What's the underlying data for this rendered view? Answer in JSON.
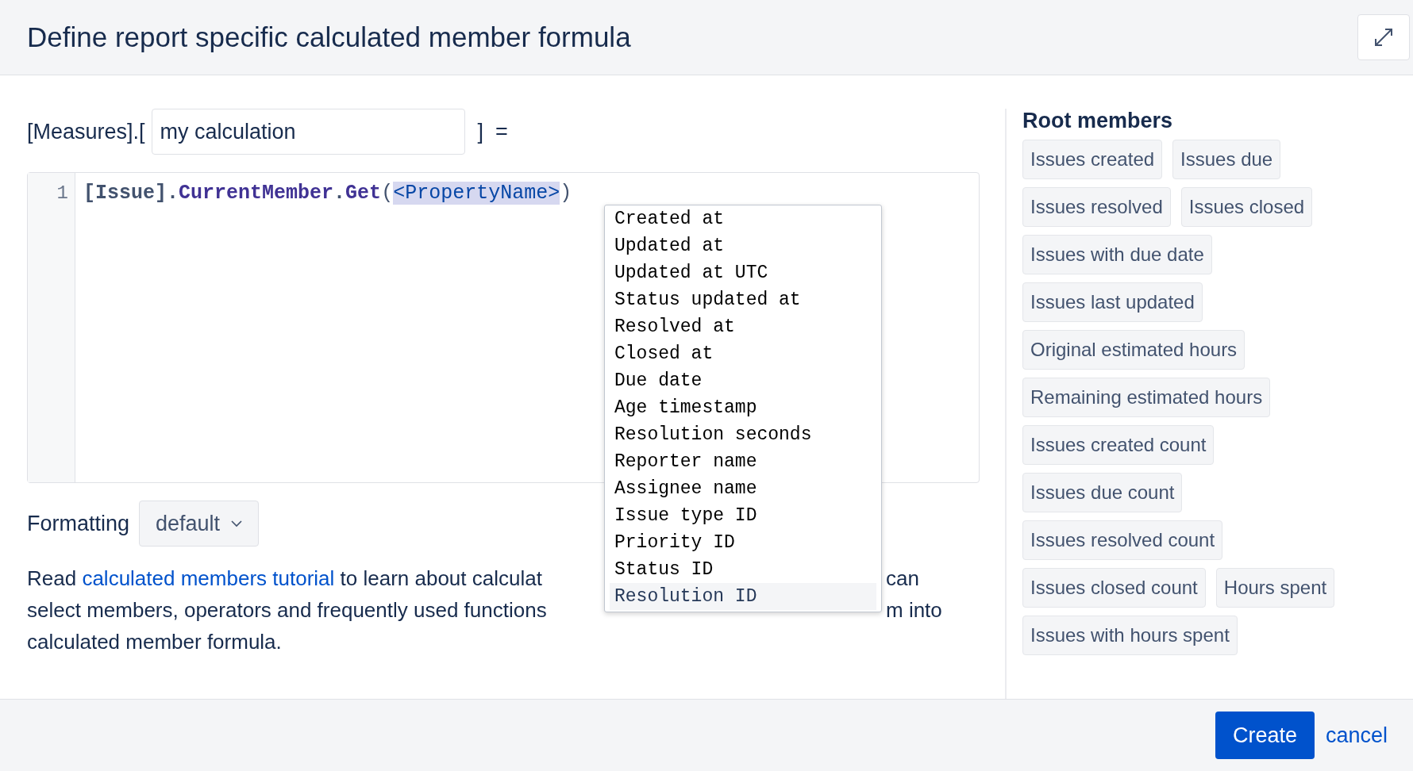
{
  "dialog": {
    "title": "Define report specific calculated member formula"
  },
  "name_row": {
    "prefix": "[Measures].[",
    "value": "my calculation",
    "suffix": "]  ="
  },
  "editor": {
    "lines": [
      {
        "number": "1",
        "tokens": [
          {
            "kind": "member",
            "text": "[Issue]"
          },
          {
            "kind": "punct",
            "text": "."
          },
          {
            "kind": "function",
            "text": "CurrentMember"
          },
          {
            "kind": "punct",
            "text": "."
          },
          {
            "kind": "function",
            "text": "Get"
          },
          {
            "kind": "paren",
            "text": "("
          },
          {
            "kind": "placeholder",
            "text": "<PropertyName>"
          },
          {
            "kind": "paren",
            "text": ")"
          }
        ]
      }
    ]
  },
  "autocomplete": [
    {
      "label": "Created at",
      "selected": false
    },
    {
      "label": "Updated at",
      "selected": false
    },
    {
      "label": "Updated at UTC",
      "selected": false
    },
    {
      "label": "Status updated at",
      "selected": false
    },
    {
      "label": "Resolved at",
      "selected": false
    },
    {
      "label": "Closed at",
      "selected": false
    },
    {
      "label": "Due date",
      "selected": false
    },
    {
      "label": "Age timestamp",
      "selected": false
    },
    {
      "label": "Resolution seconds",
      "selected": false
    },
    {
      "label": "Reporter name",
      "selected": false
    },
    {
      "label": "Assignee name",
      "selected": false
    },
    {
      "label": "Issue type ID",
      "selected": false
    },
    {
      "label": "Priority ID",
      "selected": false
    },
    {
      "label": "Status ID",
      "selected": false
    },
    {
      "label": "Resolution ID",
      "selected": true
    }
  ],
  "formatting": {
    "label": "Formatting",
    "value": "default"
  },
  "help": {
    "lines": [
      {
        "segments": [
          {
            "kind": "text",
            "text": "Read "
          },
          {
            "kind": "link",
            "text": "calculated members tutorial"
          },
          {
            "kind": "text",
            "text": " to learn about calculat"
          }
        ],
        "right": "can"
      },
      {
        "segments": [
          {
            "kind": "text",
            "text": "select members, operators and frequently used functions"
          }
        ],
        "right": "m into"
      },
      {
        "segments": [
          {
            "kind": "text",
            "text": "calculated member formula."
          }
        ]
      }
    ]
  },
  "sidebar": {
    "title": "Root members",
    "members": [
      "Issues created",
      "Issues due",
      "Issues resolved",
      "Issues closed",
      "Issues with due date",
      "Issues last updated",
      "Original estimated hours",
      "Remaining estimated hours",
      "Issues created count",
      "Issues due count",
      "Issues resolved count",
      "Issues closed count",
      "Hours spent",
      "Issues with hours spent"
    ]
  },
  "footer": {
    "primary": "Create",
    "secondary": "cancel"
  }
}
